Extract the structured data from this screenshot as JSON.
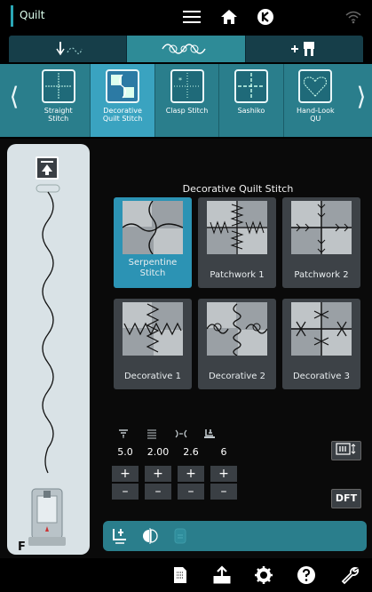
{
  "app": {
    "mode": "Quilt"
  },
  "topbar": {
    "icons": [
      "menu-icon",
      "home-icon",
      "jukibrand-icon",
      "wifi-icon"
    ]
  },
  "tabs": [
    {
      "name": "utility-stitches",
      "icon": "needle-stitch-icon",
      "active": false
    },
    {
      "name": "decorative-stitches",
      "icon": "decorative-stitch-icon",
      "active": true
    },
    {
      "name": "add-presser-foot",
      "icon": "plus-foot-icon",
      "active": false
    }
  ],
  "stitch_strip": {
    "prev_arrow": "⟨",
    "next_arrow": "⟩",
    "items": [
      {
        "label": "Straight\nStitch",
        "active": false
      },
      {
        "label": "Decorative\nQuilt Stitch",
        "active": true
      },
      {
        "label": "Clasp Stitch",
        "active": false
      },
      {
        "label": "Sashiko",
        "active": false
      },
      {
        "label": "Hand-Look\nQU",
        "active": false
      }
    ]
  },
  "grid": {
    "title": "Decorative Quilt Stitch",
    "cells": [
      {
        "label": "Serpentine\nStitch",
        "active": true
      },
      {
        "label": "Patchwork 1",
        "active": false
      },
      {
        "label": "Patchwork 2",
        "active": false
      },
      {
        "label": "Decorative 1",
        "active": false
      },
      {
        "label": "Decorative 2",
        "active": false
      },
      {
        "label": "Decorative 3",
        "active": false
      }
    ]
  },
  "params": {
    "icons": [
      "tension-icon",
      "stitch-length-icon",
      "stitch-width-icon",
      "presser-foot-pressure-icon"
    ],
    "values": [
      "5.0",
      "2.00",
      "2.6",
      "6"
    ],
    "plus": "+",
    "minus": "–"
  },
  "side_buttons": {
    "dft": "DFT"
  },
  "left_panel": {
    "foot_letter": "F"
  },
  "bottombar": {
    "icons": [
      "file-icon",
      "export-icon",
      "settings-icon",
      "help-icon",
      "wrench-icon"
    ]
  },
  "colors": {
    "accent": "#2a7e8c",
    "active": "#3aa3c0",
    "panel": "#d9e2e6"
  }
}
